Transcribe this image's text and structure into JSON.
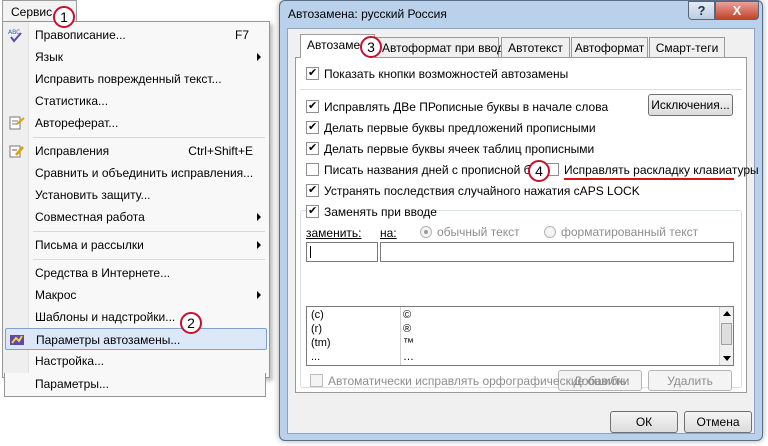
{
  "menu": {
    "title": "Сервис",
    "items": [
      {
        "label": "Правописание...",
        "shortcut": "F7"
      },
      {
        "label": "Язык"
      },
      {
        "label": "Исправить поврежденный текст..."
      },
      {
        "label": "Статистика..."
      },
      {
        "label": "Автореферат..."
      },
      {
        "label": "Исправления",
        "shortcut": "Ctrl+Shift+E"
      },
      {
        "label": "Сравнить и объединить исправления..."
      },
      {
        "label": "Установить защиту..."
      },
      {
        "label": "Совместная работа"
      },
      {
        "label": "Письма и рассылки"
      },
      {
        "label": "Средства в Интернете..."
      },
      {
        "label": "Макрос"
      },
      {
        "label": "Шаблоны и надстройки..."
      },
      {
        "label": "Параметры автозамены..."
      },
      {
        "label": "Настройка..."
      },
      {
        "label": "Параметры..."
      }
    ]
  },
  "dialog": {
    "title": "Автозамена: русский Россия",
    "help_label": "?",
    "close_label": "X",
    "tabs": [
      "Автозамена",
      "Автоформат при вводе",
      "Автотекст",
      "Автоформат",
      "Смарт-теги"
    ],
    "show_buttons": "Показать кнопки возможностей автозамены",
    "options": [
      "Исправлять ДВе ПРописные буквы в начале слова",
      "Делать первые буквы предложений прописными",
      "Делать первые буквы ячеек таблиц прописными",
      "Писать названия дней с прописной буквы",
      "Устранять последствия случайного нажатия cAPS LOCK"
    ],
    "fix_keyboard": "Исправлять раскладку клавиатуры",
    "exceptions_button": "Исключения...",
    "replace_while_typing": "Заменять при вводе",
    "replace_label": "заменить:",
    "with_label": "на:",
    "plain_text": "обычный текст",
    "formatted_text": "форматированный текст",
    "table": [
      {
        "from": "(c)",
        "to": "©"
      },
      {
        "from": "(r)",
        "to": "®"
      },
      {
        "from": "(tm)",
        "to": "™"
      },
      {
        "from": "...",
        "to": "…"
      }
    ],
    "add_button": "Добавить",
    "delete_button": "Удалить",
    "auto_spell": "Автоматически исправлять орфографические ошибки",
    "ok_button": "ОК",
    "cancel_button": "Отмена"
  },
  "callouts": [
    "1",
    "2",
    "3",
    "4"
  ],
  "colors": {
    "accent_red": "#c8102e",
    "highlight": "#dce8f8"
  }
}
